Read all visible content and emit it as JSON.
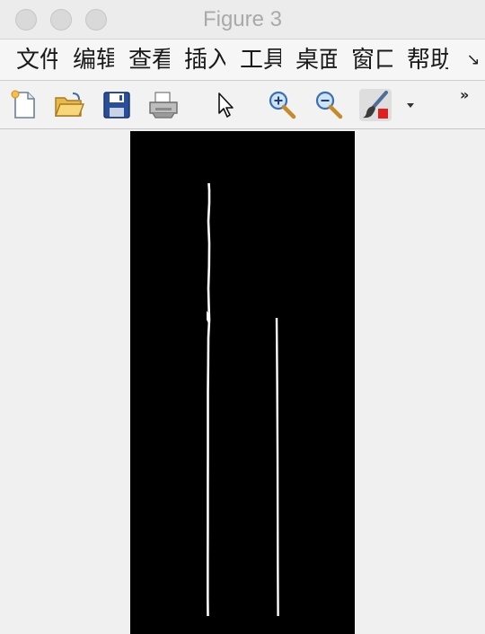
{
  "window": {
    "title": "Figure 3"
  },
  "menubar": {
    "items": [
      {
        "label": "文件"
      },
      {
        "label": "编辑"
      },
      {
        "label": "查看"
      },
      {
        "label": "插入"
      },
      {
        "label": "工具"
      },
      {
        "label": "桌面"
      },
      {
        "label": "窗口"
      },
      {
        "label": "帮助"
      }
    ]
  },
  "toolbar": {
    "tools": [
      {
        "name": "new-figure-icon"
      },
      {
        "name": "open-file-icon"
      },
      {
        "name": "save-icon"
      },
      {
        "name": "print-icon"
      },
      {
        "name": "pointer-icon"
      },
      {
        "name": "zoom-in-icon"
      },
      {
        "name": "zoom-out-icon"
      },
      {
        "name": "brush-icon"
      },
      {
        "name": "dropdown-arrow-icon"
      }
    ],
    "overflow_label": "»"
  },
  "colors": {
    "plot_background": "#000000",
    "plot_lines": "#ffffff",
    "brush_accent": "#e02020"
  }
}
